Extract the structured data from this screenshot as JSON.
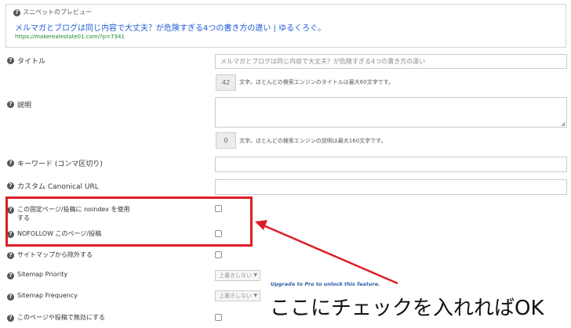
{
  "preview": {
    "label": "スニペットのプレビュー",
    "title": "メルマガとブログは同じ内容で大丈夫？が危険すぎる4つの書き方の違い | ゆるくろぐ。",
    "url": "https://makerealestate01.com/?p=7341"
  },
  "title_field": {
    "label": "タイトル",
    "placeholder": "メルマガとブログは同じ内容で大丈夫？が危険すぎる4つの書き方の違い",
    "count": "42",
    "note": "文字。ほとんどの検索エンジンのタイトルは最大60文字です。"
  },
  "desc_field": {
    "label": "説明",
    "count": "0",
    "note": "文字。ほとんどの検索エンジンの説明は最大160文字です。"
  },
  "keywords": {
    "label": "キーワード (コンマ区切り)"
  },
  "canonical": {
    "label": "カスタム Canonical URL"
  },
  "noindex": {
    "label_line1": "この固定ページ/投稿に noindex を使用",
    "label_line2": "する"
  },
  "nofollow": {
    "label": "NOFOLLOW このページ/投稿"
  },
  "sitemap_exclude": {
    "label": "サイトマップから除外する"
  },
  "sitemap_priority": {
    "label": "Sitemap Priority",
    "value": "上書きしない"
  },
  "sitemap_frequency": {
    "label": "Sitemap Frequency",
    "value": "上書きしない"
  },
  "upgrade_note": "Upgrade to Pro to unlock this feature.",
  "disable_label": "このページや投稿で無効にする",
  "annotation": {
    "text": "ここにチェックを入れればOK",
    "color": "#dd1f26"
  },
  "colors": {
    "link": "#1e5bd6",
    "url": "#1a8a2e",
    "upgrade": "#2e5fa7",
    "highlight": "#dd1f26"
  }
}
